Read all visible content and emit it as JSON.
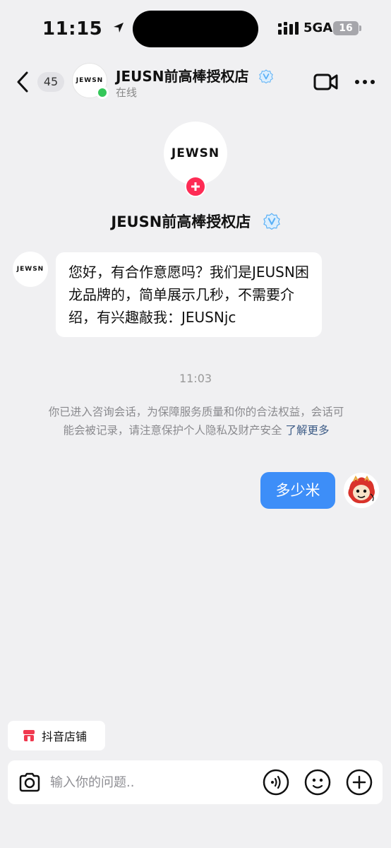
{
  "status_bar": {
    "time": "11:15",
    "network": "5GA",
    "battery": "16"
  },
  "header": {
    "unread_count": "45",
    "avatar_logo": "JEWSN",
    "title": "JEUSN前高棒授权店",
    "status": "在线"
  },
  "profile": {
    "logo": "JEWSN",
    "name": "JEUSN前高棒授权店"
  },
  "messages": {
    "incoming": {
      "avatar_logo": "JEWSN",
      "text": " 您好，有合作意愿吗？我们是JEUSN困龙品牌的，简单展示几秒，不需要介绍，有兴趣敲我：JEUSNjc"
    },
    "timestamp": "11:03",
    "notice_text": "你已进入咨询会话，为保障服务质量和你的合法权益，会话可能会被记录，请注意保护个人隐私及财产安全 ",
    "notice_link": "了解更多",
    "outgoing": {
      "text": "多少米"
    }
  },
  "store_chip": {
    "label": "抖音店铺"
  },
  "input_bar": {
    "placeholder": "输入你的问题.."
  },
  "colors": {
    "accent_blue": "#3d8ef8",
    "follow_red": "#fe2c55",
    "online_green": "#34c759",
    "verify_blue": "#5ab0f6",
    "link_blue": "#3c5b86"
  }
}
